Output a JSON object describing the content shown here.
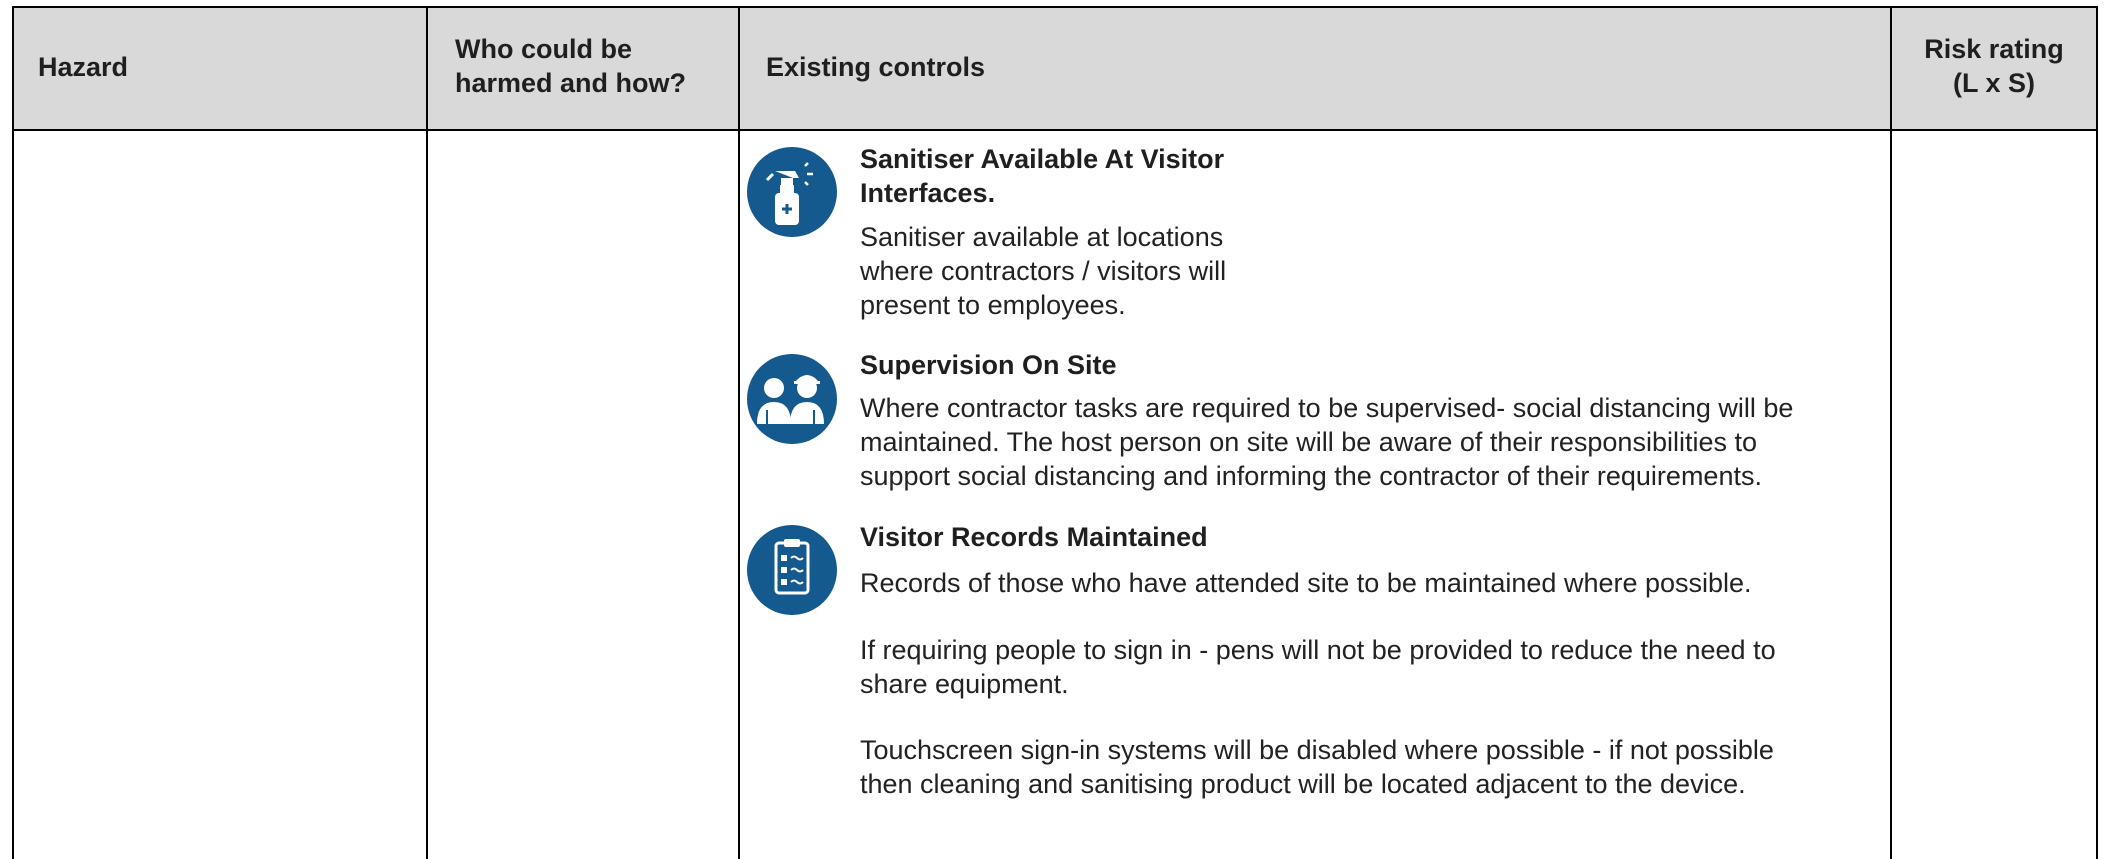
{
  "table": {
    "headers": {
      "hazard": "Hazard",
      "who_line1": "Who could be",
      "who_line2": "harmed and how?",
      "controls": "Existing controls",
      "risk_line1": "Risk rating",
      "risk_line2": "(L x S)"
    },
    "controls": [
      {
        "icon": "spray-bottle-icon",
        "title_lines": [
          "Sanitiser Available At Visitor",
          "Interfaces."
        ],
        "text_lines": [
          "Sanitiser available at locations",
          "where contractors / visitors will",
          "present to employees."
        ]
      },
      {
        "icon": "supervisors-icon",
        "title_lines": [
          "Supervision On Site"
        ],
        "text_lines": [
          "Where contractor tasks are required to be supervised- social distancing will be",
          "maintained. The host person on site will be aware of their responsibilities to",
          "support social distancing and informing the contractor of their requirements."
        ]
      },
      {
        "icon": "clipboard-checklist-icon",
        "title_lines": [
          "Visitor Records Maintained"
        ],
        "paragraphs": [
          [
            "Records of those who have attended site to be maintained where possible."
          ],
          [
            "If requiring people to sign in - pens will not be provided to reduce the need to",
            "share equipment."
          ],
          [
            "Touchscreen sign-in systems will be disabled where possible - if not possible",
            "then cleaning and sanitising product will be located adjacent to the device."
          ]
        ]
      }
    ]
  },
  "colors": {
    "header_bg": "#d9d9d9",
    "icon_blue": "#155a8f"
  }
}
